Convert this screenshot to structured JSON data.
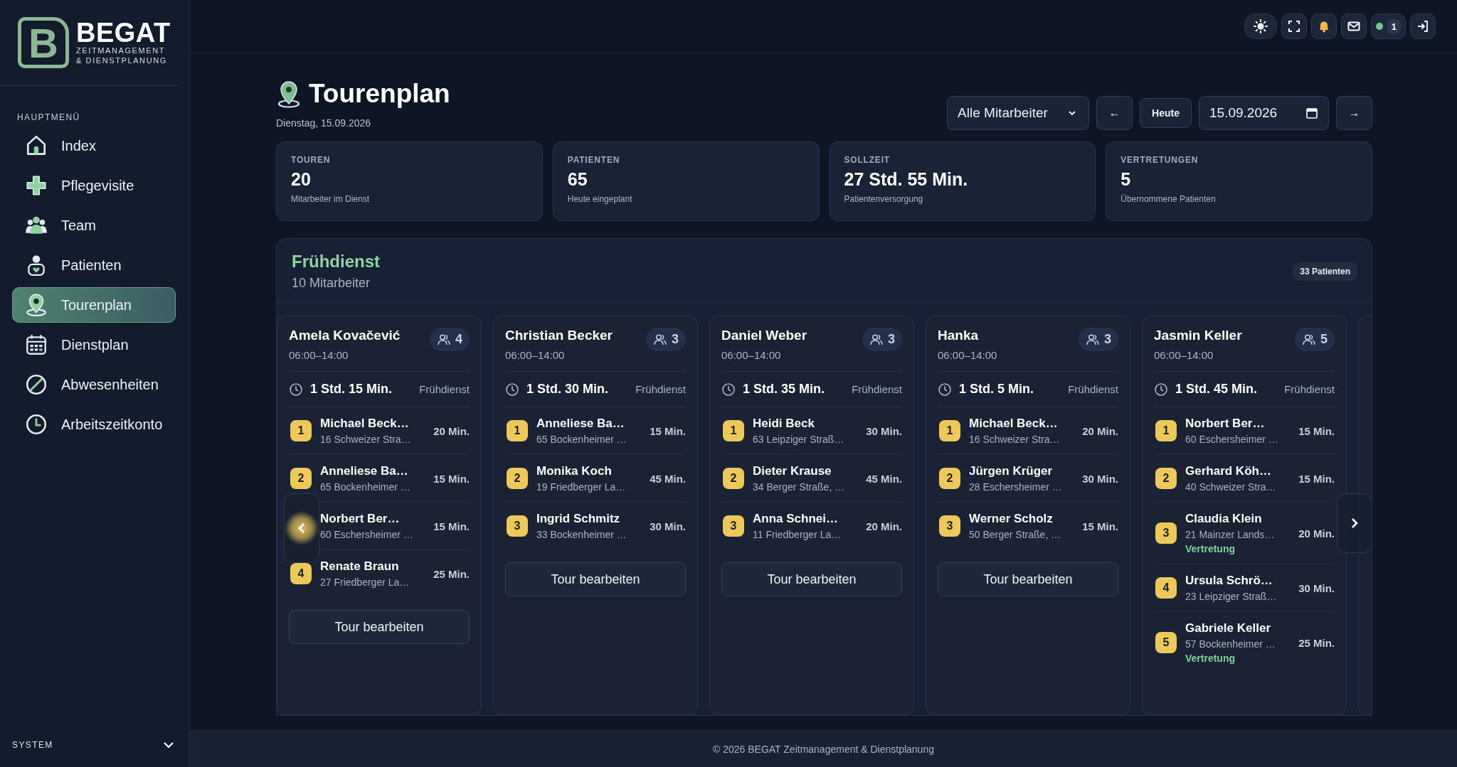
{
  "sidebar": {
    "logo": {
      "mark": "B",
      "name": "BEGAT",
      "tagline": [
        "ZEITMANAGEMENT",
        "& DIENSTPLANUNG"
      ]
    },
    "section_title": "HAUPTMENÜ",
    "items": [
      {
        "label": "Index",
        "selected": false
      },
      {
        "label": "Pflegevisite",
        "selected": false
      },
      {
        "label": "Team",
        "selected": false
      },
      {
        "label": "Patienten",
        "selected": false
      },
      {
        "label": "Tourenplan",
        "selected": true
      },
      {
        "label": "Dienstplan",
        "selected": false
      },
      {
        "label": "Abwesenheiten",
        "selected": false
      },
      {
        "label": "Arbeitszeitkonto",
        "selected": false
      }
    ],
    "system": {
      "label": "SYSTEM",
      "expanded": false
    }
  },
  "top_bar": {
    "status": {
      "online": true,
      "count": "1"
    }
  },
  "page": {
    "title": "Tourenplan",
    "subtitle": "Dienstag, 15.09.2026",
    "filter": "Alle Mitarbeiter",
    "prev": "←",
    "today": "Heute",
    "date": "15.09.2026",
    "next": "→"
  },
  "stats": [
    {
      "label": "TOUREN",
      "value": "20",
      "note": "Mitarbeiter im Dienst"
    },
    {
      "label": "PATIENTEN",
      "value": "65",
      "note": "Heute eingeplant"
    },
    {
      "label": "SOLLZEIT",
      "value": "27 Std. 55 Min.",
      "note": "Patientenversorgung"
    },
    {
      "label": "VERTRETUNGEN",
      "value": "5",
      "note": "Übernommene Patienten"
    }
  ],
  "shift": {
    "title": "Frühdienst",
    "subtitle": "10 Mitarbeiter",
    "badge": "33 Patienten",
    "tours": [
      {
        "employee": "Amela Kovačević",
        "hours": "06:00–14:00",
        "patients": "4",
        "total": "1 Std. 15 Min.",
        "shift": "Frühdienst",
        "button": "Tour bearbeiten",
        "stops": [
          {
            "number": "1",
            "name": "Michael Beck…",
            "address": "16 Schweizer Stra…",
            "duration": "20 Min."
          },
          {
            "number": "2",
            "name": "Anneliese Ba…",
            "address": "65 Bockenheimer …",
            "duration": "15 Min."
          },
          {
            "name": "Norbert Ber…",
            "address": "60 Eschersheimer …",
            "duration": "15 Min."
          },
          {
            "number": "4",
            "name": "Renate Braun",
            "address": "27 Friedberger La…",
            "duration": "25 Min."
          }
        ]
      },
      {
        "employee": "Christian Becker",
        "hours": "06:00–14:00",
        "patients": "3",
        "total": "1 Std. 30 Min.",
        "shift": "Frühdienst",
        "button": "Tour bearbeiten",
        "stops": [
          {
            "number": "1",
            "name": "Anneliese Ba…",
            "address": "65 Bockenheimer …",
            "duration": "15 Min."
          },
          {
            "number": "2",
            "name": "Monika Koch",
            "address": "19 Friedberger La…",
            "duration": "45 Min."
          },
          {
            "number": "3",
            "name": "Ingrid Schmitz",
            "address": "33 Bockenheimer …",
            "duration": "30 Min."
          }
        ]
      },
      {
        "employee": "Daniel Weber",
        "hours": "06:00–14:00",
        "patients": "3",
        "total": "1 Std. 35 Min.",
        "shift": "Frühdienst",
        "button": "Tour bearbeiten",
        "stops": [
          {
            "number": "1",
            "name": "Heidi Beck",
            "address": "63 Leipziger Straß…",
            "duration": "30 Min."
          },
          {
            "number": "2",
            "name": "Dieter Krause",
            "address": "34 Berger Straße, …",
            "duration": "45 Min."
          },
          {
            "number": "3",
            "name": "Anna Schnei…",
            "address": "11 Friedberger La…",
            "duration": "20 Min."
          }
        ]
      },
      {
        "employee": "Hanka",
        "hours": "06:00–14:00",
        "patients": "3",
        "total": "1 Std. 5 Min.",
        "shift": "Frühdienst",
        "button": "Tour bearbeiten",
        "stops": [
          {
            "number": "1",
            "name": "Michael Beck…",
            "address": "16 Schweizer Stra…",
            "duration": "20 Min."
          },
          {
            "number": "2",
            "name": "Jürgen Krüger",
            "address": "28 Eschersheimer …",
            "duration": "30 Min."
          },
          {
            "number": "3",
            "name": "Werner Scholz",
            "address": "50 Berger Straße, …",
            "duration": "15 Min."
          }
        ]
      },
      {
        "employee": "Jasmin Keller",
        "hours": "06:00–14:00",
        "patients": "5",
        "total": "1 Std. 45 Min.",
        "shift": "Frühdienst",
        "stops": [
          {
            "number": "1",
            "name": "Norbert Ber…",
            "address": "60 Eschersheimer …",
            "duration": "15 Min."
          },
          {
            "number": "2",
            "name": "Gerhard Köh…",
            "address": "40 Schweizer Stra…",
            "duration": "15 Min."
          },
          {
            "number": "3",
            "name": "Claudia Klein",
            "address": "21 Mainzer Lands…",
            "duration": "20 Min.",
            "note": "Vertretung"
          },
          {
            "number": "4",
            "name": "Ursula Schrö…",
            "address": "23 Leipziger Straß…",
            "duration": "30 Min."
          },
          {
            "number": "5",
            "name": "Gabriele Keller",
            "address": "57 Bockenheimer …",
            "duration": "25 Min.",
            "note": "Vertretung"
          }
        ]
      }
    ]
  },
  "footer": "© 2026 BEGAT Zeitmanagement & Dienstplanung"
}
